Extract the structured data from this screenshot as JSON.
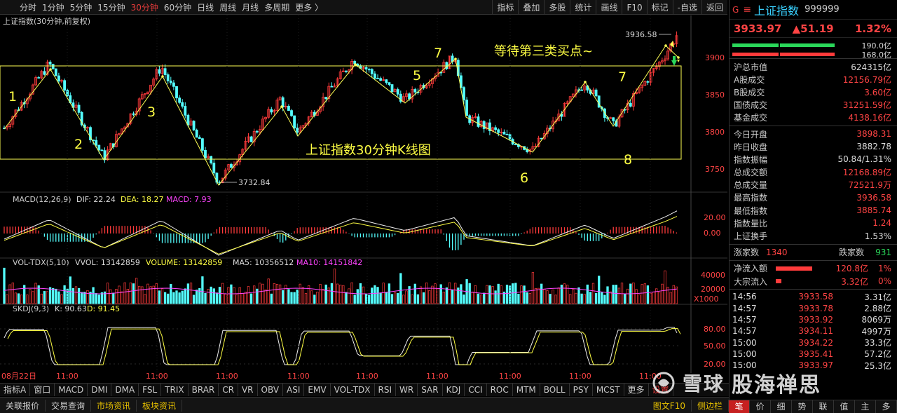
{
  "toolbar": {
    "periods": [
      "分时",
      "1分钟",
      "5分钟",
      "15分钟",
      "30分钟",
      "60分钟",
      "日线",
      "周线",
      "月线",
      "多周期",
      "更多 〉"
    ],
    "active_period": "30分钟",
    "right_buttons": [
      "指标",
      "叠加",
      "多股",
      "统计",
      "画线",
      "F10",
      "标记",
      "-自选",
      "返回"
    ]
  },
  "chart": {
    "title": "上证指数(30分钟,前复权)",
    "high_label": "3936.58",
    "low_label": "3732.84",
    "price_axis": [
      "3900",
      "3850",
      "3800",
      "3750"
    ],
    "annotation_title": "上证指数30分钟K线图",
    "annotation_wait": "等待第三类买点~",
    "wave_labels": [
      "1",
      "2",
      "3",
      "5",
      "7",
      "6",
      "7",
      "8"
    ],
    "date_label": "08月22日",
    "time_label": "11:00",
    "colors": {
      "up": "#ff3b3b",
      "down": "#54ffff",
      "box": "#ffff55",
      "text_yellow": "#ffff44"
    }
  },
  "macd": {
    "name": "MACD(12,26,9)",
    "dif": "DIF: 22.24",
    "dea": "DEA: 18.27",
    "macd": "MACD: 7.93",
    "axis": [
      "20.00",
      "0.00"
    ]
  },
  "vol": {
    "name": "VOL-TDX(5,10)",
    "vvol": "VVOL: 13142859",
    "volume": "VOLUME: 13142859",
    "ma5": "MA5: 10356512",
    "ma10": "MA10: 14151842",
    "axis": [
      "40000",
      "20000"
    ],
    "unit": "X1000"
  },
  "skdj": {
    "name": "SKDJ(9,3)",
    "k": "K: 90.63",
    "d": "D: 91.45",
    "axis": [
      "80.00",
      "50.00",
      "20.00"
    ]
  },
  "indicator_tabs": [
    "指标A",
    "窗口",
    "MACD",
    "DMI",
    "DMA",
    "FSL",
    "TRIX",
    "BRAR",
    "CR",
    "VR",
    "OBV",
    "ASI",
    "EMV",
    "VOL-TDX",
    "RSI",
    "WR",
    "SAR",
    "KDJ",
    "CCI",
    "ROC",
    "MTM",
    "BOLL",
    "PSY",
    "MCST",
    "更多",
    "设置"
  ],
  "bottom_bar": {
    "items": [
      "关联报价",
      "交易查询",
      "市场资讯",
      "板块资讯"
    ],
    "right": [
      "图文F10",
      "侧边栏"
    ]
  },
  "watermark": {
    "brand": "雪球",
    "author": "股海禅思"
  },
  "side": {
    "g": "G",
    "name": "上证指数",
    "code": "999999",
    "price": "3933.97",
    "change": "▲51.19",
    "pct": "1.32%",
    "bar1": "190.0亿",
    "bar2": "168.0亿",
    "stats1": [
      {
        "label": "沪总市值",
        "value": "624315亿",
        "cls": "val"
      },
      {
        "label": "A股成交",
        "value": "12156.79亿",
        "cls": "red"
      },
      {
        "label": "B股成交",
        "value": "3.60亿",
        "cls": "red"
      },
      {
        "label": "国债成交",
        "value": "31251.59亿",
        "cls": "red"
      },
      {
        "label": "基金成交",
        "value": "4138.16亿",
        "cls": "red"
      }
    ],
    "stats2": [
      {
        "label": "今日开盘",
        "value": "3898.31",
        "cls": "red"
      },
      {
        "label": "昨日收盘",
        "value": "3882.78",
        "cls": "val"
      },
      {
        "label": "指数振幅",
        "value": "50.84/1.31%",
        "cls": "val"
      },
      {
        "label": "总成交额",
        "value": "12168.89亿",
        "cls": "red"
      },
      {
        "label": "总成交量",
        "value": "72521.9万",
        "cls": "red"
      },
      {
        "label": "最高指数",
        "value": "3936.58",
        "cls": "red"
      },
      {
        "label": "最低指数",
        "value": "3885.74",
        "cls": "red"
      },
      {
        "label": "指数量比",
        "value": "1.24",
        "cls": "red"
      },
      {
        "label": "上证换手",
        "value": "1.53%",
        "cls": "val"
      }
    ],
    "up_label": "涨家数",
    "up_count": "1340",
    "down_label": "跌家数",
    "down_count": "931",
    "flows": [
      {
        "label": "净流入额",
        "value": "120.8亿",
        "pct": "1%"
      },
      {
        "label": "大宗流入",
        "value": "3.32亿",
        "pct": "0%"
      }
    ],
    "ticks": [
      {
        "t": "14:56",
        "p": "3933.58",
        "v": "3.31亿"
      },
      {
        "t": "14:57",
        "p": "3933.78",
        "v": "2.88亿"
      },
      {
        "t": "14:57",
        "p": "3933.92",
        "v": "8069万"
      },
      {
        "t": "14:57",
        "p": "3934.11",
        "v": "4997万"
      },
      {
        "t": "15:00",
        "p": "3934.22",
        "v": "33.3亿"
      },
      {
        "t": "15:00",
        "p": "3935.41",
        "v": "57.2亿"
      },
      {
        "t": "15:00",
        "p": "3933.97",
        "v": "25.3亿"
      }
    ],
    "tabs": [
      "笔",
      "价",
      "细",
      "势",
      "联",
      "值",
      "主",
      "多"
    ]
  }
}
